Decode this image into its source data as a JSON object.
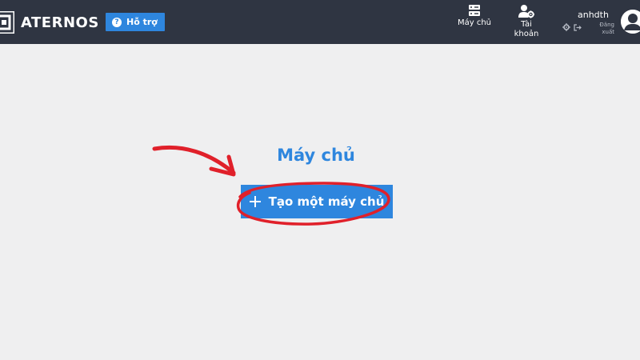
{
  "header": {
    "logo_text": "ATERNOS",
    "help_label": "Hỗ trợ",
    "nav": [
      {
        "label": "Máy chủ",
        "icon": "servers-icon"
      },
      {
        "label": "Tài khoản",
        "icon": "account-icon"
      }
    ],
    "user": {
      "username": "anhdth",
      "logout_label": "Đăng xuất",
      "settings_icon": "gear-icon",
      "logout_icon": "logout-icon",
      "avatar_icon": "user-avatar-icon"
    }
  },
  "main": {
    "title": "Máy chủ",
    "create_button_label": "Tạo một máy chủ"
  },
  "colors": {
    "topbar": "#2f3542",
    "accent": "#2e86de",
    "background": "#efeff0",
    "annotation": "#e0202a"
  }
}
